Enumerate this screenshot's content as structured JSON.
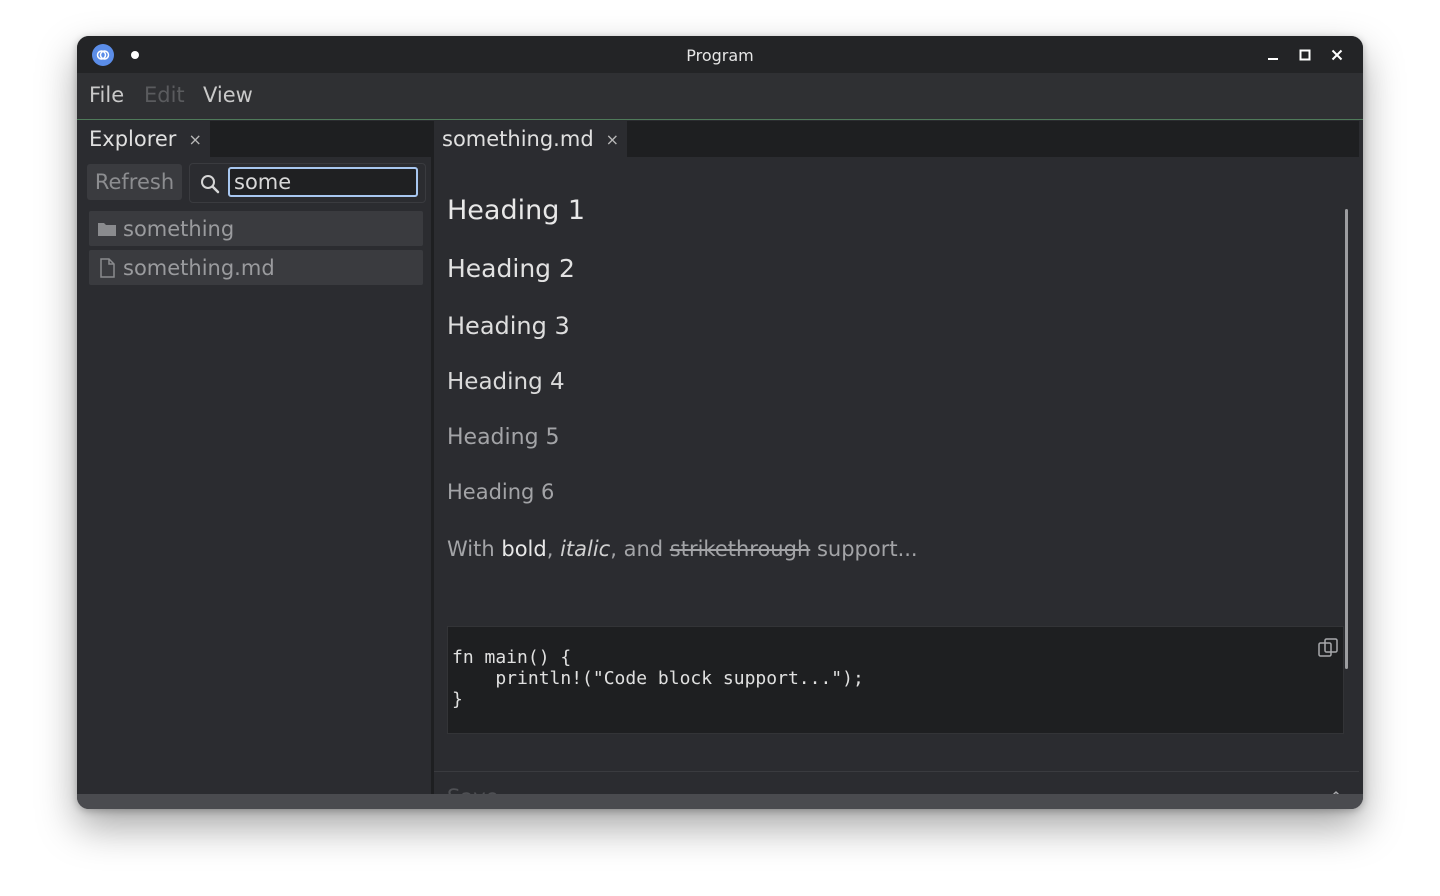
{
  "window": {
    "title": "Program",
    "icons": {
      "logo": "app-logo-icon",
      "minimize": "minimize-icon",
      "maximize": "maximize-icon",
      "close": "close-icon"
    }
  },
  "menubar": {
    "items": [
      {
        "label": "File",
        "enabled": true
      },
      {
        "label": "Edit",
        "enabled": false
      },
      {
        "label": "View",
        "enabled": true
      }
    ]
  },
  "explorer": {
    "tab_label": "Explorer",
    "tab_close": "×",
    "refresh_label": "Refresh",
    "search_value": "some",
    "items": [
      {
        "label": "something",
        "icon": "folder-icon"
      },
      {
        "label": "something.md",
        "icon": "file-icon"
      }
    ]
  },
  "editor": {
    "tab_label": "something.md",
    "tab_close": "×",
    "headings": [
      "Heading 1",
      "Heading 2",
      "Heading 3",
      "Heading 4",
      "Heading 5",
      "Heading 6"
    ],
    "paragraph": {
      "p1": "With ",
      "bold": "bold",
      "p2": ", ",
      "italic": "italic",
      "p3": ", and ",
      "strike": "strikethrough",
      "p4": " support..."
    },
    "code": "fn main() {\n    println!(\"Code block support...\");\n}",
    "save_label": "Save"
  },
  "colors": {
    "accent": "#4f7a5a",
    "focus": "#a8c7f0",
    "logo": "#5b8de8"
  }
}
